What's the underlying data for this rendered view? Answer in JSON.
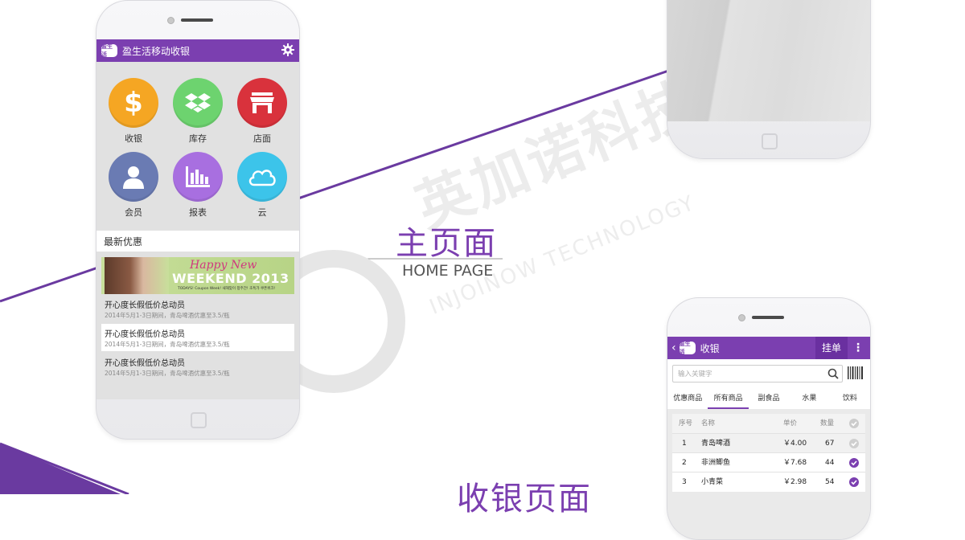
{
  "colors": {
    "brand_purple": "#7b3fb0",
    "cash_orange": "#f5a623",
    "stock_green": "#6dd36f",
    "store_red": "#d9323c",
    "member_blue": "#6a7bb3",
    "report_violet": "#a86fe0",
    "cloud_cyan": "#3cc4ea"
  },
  "home_phone": {
    "app_title": "盈生活移动收银",
    "logo_text": "盈生活",
    "functions": [
      {
        "label": "收银",
        "icon": "dollar-icon"
      },
      {
        "label": "库存",
        "icon": "box-icon"
      },
      {
        "label": "店面",
        "icon": "storefront-icon"
      },
      {
        "label": "会员",
        "icon": "person-icon"
      },
      {
        "label": "报表",
        "icon": "bar-chart-icon"
      },
      {
        "label": "云",
        "icon": "cloud-icon"
      }
    ],
    "promo_section_title": "最新优惠",
    "banner": {
      "headline": "Happy New",
      "big_text": "WEEKEND 2013",
      "small_text": "TODAYS! Coupon Week! 새해맞이 창주간! 초특가 쿠폰위크!"
    },
    "promos": [
      {
        "title": "开心度长假低价总动员",
        "subtitle": "2014年5月1-3日期间，青岛啤酒优惠至3.5/瓶"
      },
      {
        "title": "开心度长假低价总动员",
        "subtitle": "2014年5月1-3日期间，青岛啤酒优惠至3.5/瓶"
      },
      {
        "title": "开心度长假低价总动员",
        "subtitle": "2014年5月1-3日期间，青岛啤酒优惠至3.5/瓶"
      }
    ]
  },
  "center": {
    "title_cn": "主页面",
    "title_en": "HOME PAGE",
    "watermark_cn": "英加诺科技",
    "watermark_en": "INJOINOW TECHNOLOGY",
    "bottom_title": "收银页面"
  },
  "cash_phone": {
    "back": "‹",
    "logo_text": "盈生活",
    "title": "收银",
    "hold_label": "挂单",
    "menu": "⋮",
    "search_placeholder": "输入关键字",
    "tabs": [
      "优惠商品",
      "所有商品",
      "副食品",
      "水果",
      "饮料"
    ],
    "active_tab": 1,
    "columns": [
      "序号",
      "名称",
      "单价",
      "数量"
    ],
    "rows": [
      {
        "no": "1",
        "name": "青岛啤酒",
        "price": "￥4.00",
        "qty": "67",
        "checked": false
      },
      {
        "no": "2",
        "name": "非洲鲫鱼",
        "price": "￥7.68",
        "qty": "44",
        "checked": true
      },
      {
        "no": "3",
        "name": "小青菜",
        "price": "￥2.98",
        "qty": "54",
        "checked": true
      }
    ]
  }
}
